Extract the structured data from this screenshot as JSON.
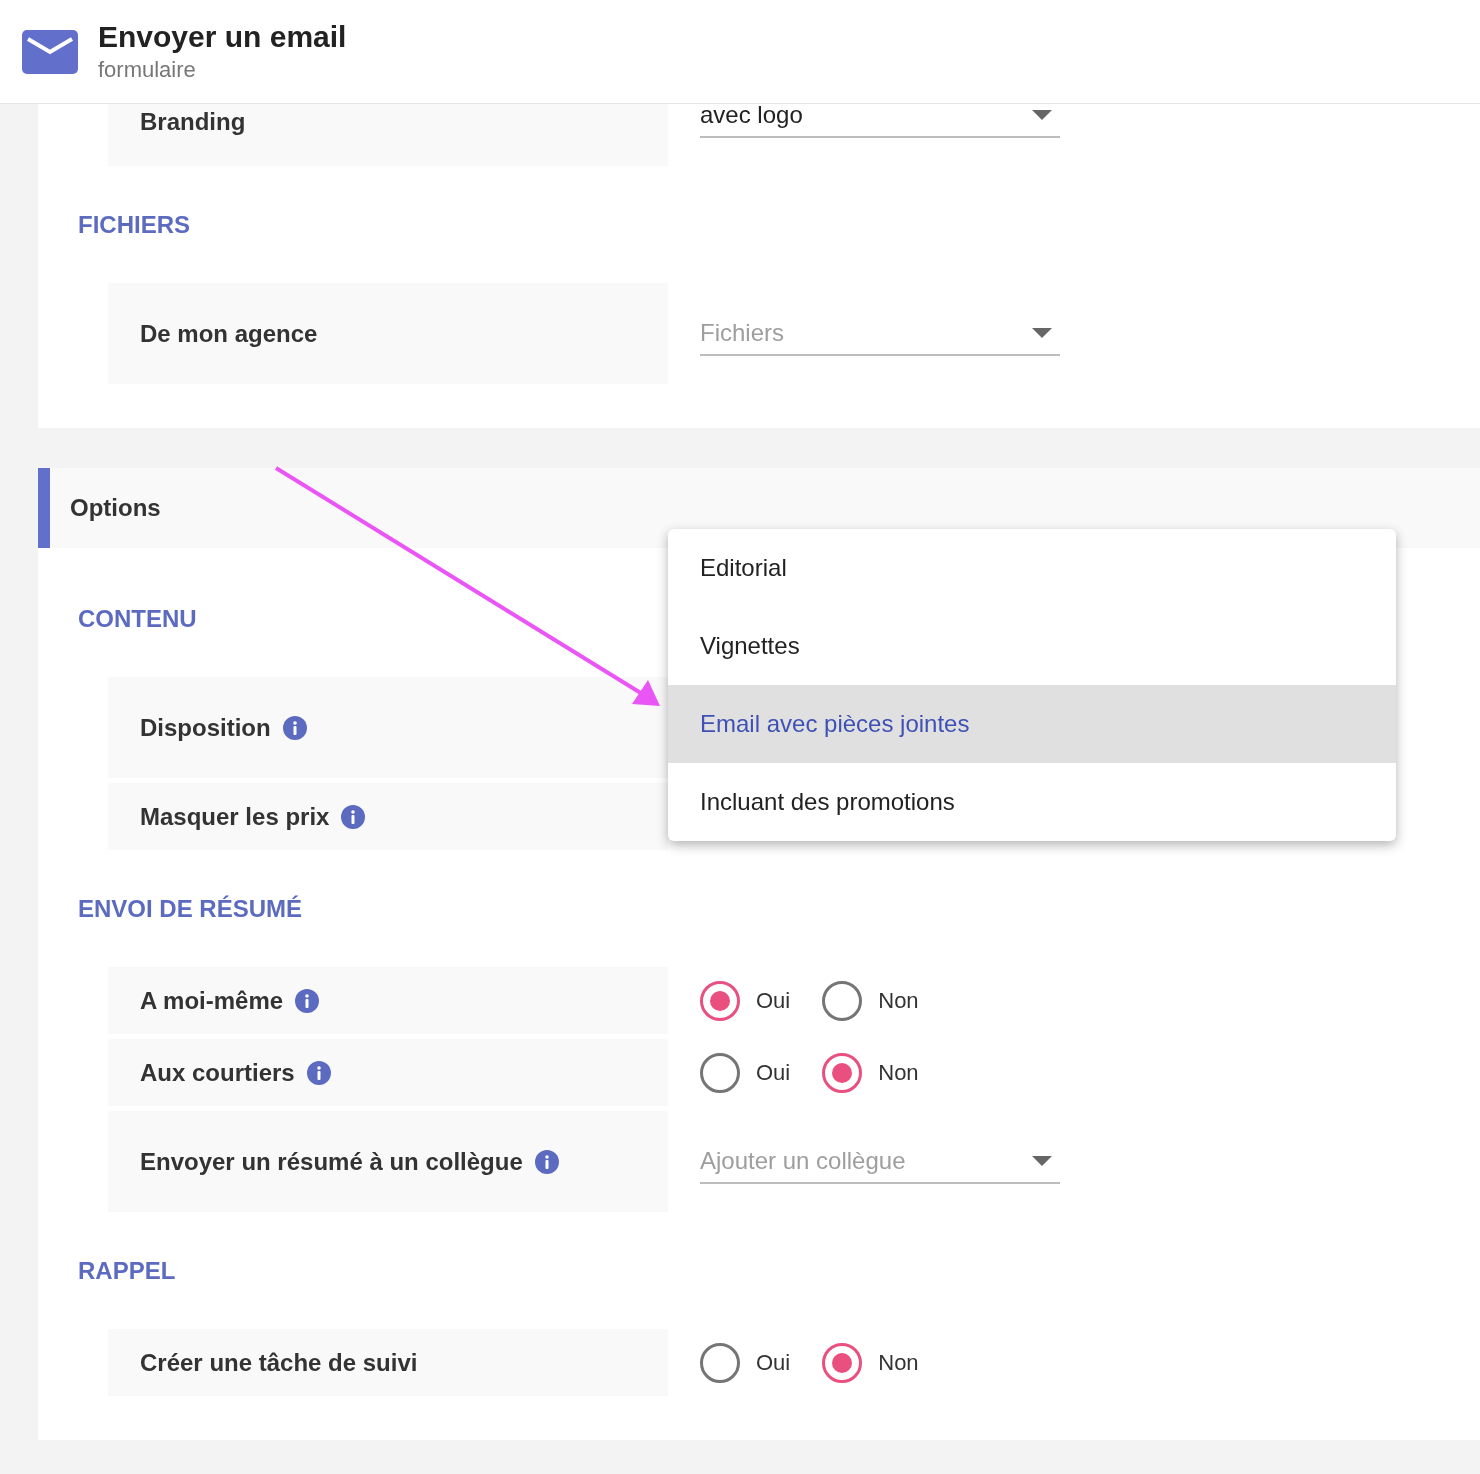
{
  "header": {
    "title": "Envoyer un email",
    "subtitle": "formulaire"
  },
  "top_card": {
    "cut_row": {
      "label": "Branding",
      "kind": "select",
      "value": "avec logo"
    },
    "sections": [
      {
        "heading": "FICHIERS",
        "rows": [
          {
            "label": "De mon agence",
            "info": false,
            "kind": "select",
            "placeholder": "Fichiers"
          }
        ]
      }
    ]
  },
  "options_panel": {
    "title": "Options",
    "sections": [
      {
        "heading": "CONTENU",
        "rows": [
          {
            "label": "Disposition",
            "info": true,
            "kind": "select"
          },
          {
            "label": "Masquer les prix",
            "info": true,
            "kind": "plain"
          }
        ]
      },
      {
        "heading": "ENVOI DE RÉSUMÉ",
        "rows": [
          {
            "label": "A moi-même",
            "info": true,
            "kind": "radio",
            "options": [
              {
                "label": "Oui",
                "selected": true
              },
              {
                "label": "Non",
                "selected": false
              }
            ]
          },
          {
            "label": "Aux courtiers",
            "info": true,
            "kind": "radio",
            "options": [
              {
                "label": "Oui",
                "selected": false
              },
              {
                "label": "Non",
                "selected": true
              }
            ]
          },
          {
            "label": "Envoyer un résumé à un collègue",
            "info": true,
            "kind": "select",
            "placeholder": "Ajouter un collègue"
          }
        ]
      },
      {
        "heading": "RAPPEL",
        "rows": [
          {
            "label": "Créer une tâche de suivi",
            "info": false,
            "kind": "radio",
            "options": [
              {
                "label": "Oui",
                "selected": false
              },
              {
                "label": "Non",
                "selected": true
              }
            ]
          }
        ]
      }
    ]
  },
  "dropdown": {
    "items": [
      {
        "label": "Editorial",
        "selected": false
      },
      {
        "label": "Vignettes",
        "selected": false
      },
      {
        "label": "Email avec pièces jointes",
        "selected": true
      },
      {
        "label": "Incluant des promotions",
        "selected": false
      }
    ]
  }
}
